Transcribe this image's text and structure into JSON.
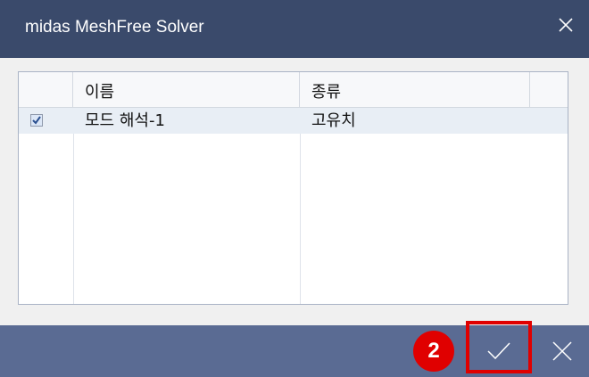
{
  "window": {
    "title": "midas MeshFree Solver"
  },
  "grid": {
    "columns": [
      "이름",
      "종류"
    ],
    "rows": [
      {
        "checked": true,
        "name": "모드 해석-1",
        "type": "고유치"
      }
    ]
  },
  "footer": {
    "step_badge": "2"
  },
  "colors": {
    "titlebar": "#3a4a6b",
    "footer": "#5a6b93",
    "highlight": "#e00000",
    "selected_row": "#e8eef5"
  },
  "icons": {
    "close": "close-icon",
    "ok": "checkmark-icon",
    "cancel": "cancel-x-icon",
    "checkbox": "checkbox-checked-icon"
  }
}
